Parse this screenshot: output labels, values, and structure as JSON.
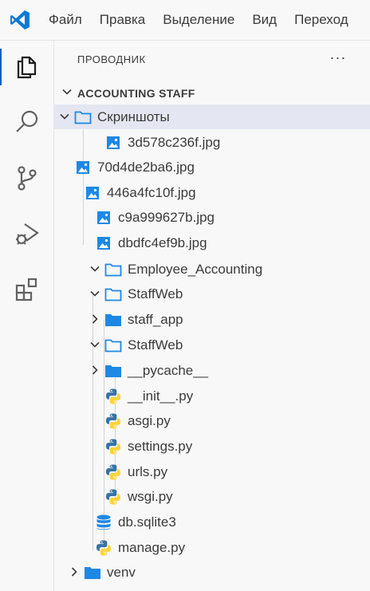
{
  "menu": {
    "items": [
      "Файл",
      "Правка",
      "Выделение",
      "Вид",
      "Переход"
    ]
  },
  "explorer": {
    "title": "ПРОВОДНИК",
    "more_actions": "···",
    "workspace": "ACCOUNTING STAFF"
  },
  "tree": [
    {
      "label": "Скриншоты",
      "kind": "folder",
      "open": true,
      "icon": "folder-open-icon"
    },
    {
      "label": "3d578c236f.jpg",
      "kind": "image",
      "icon": "image-file-icon"
    },
    {
      "label": "70d4de2ba6.jpg",
      "kind": "image",
      "icon": "image-file-icon"
    },
    {
      "label": "446a4fc10f.jpg",
      "kind": "image",
      "icon": "image-file-icon"
    },
    {
      "label": "c9a999627b.jpg",
      "kind": "image",
      "icon": "image-file-icon"
    },
    {
      "label": "dbdfc4ef9b.jpg",
      "kind": "image",
      "icon": "image-file-icon"
    },
    {
      "label": "Employee_Accounting",
      "kind": "folder",
      "open": true,
      "icon": "folder-open-icon"
    },
    {
      "label": "StaffWeb",
      "kind": "folder",
      "open": true,
      "icon": "folder-open-icon"
    },
    {
      "label": "staff_app",
      "kind": "folder",
      "open": false,
      "icon": "folder-closed-icon"
    },
    {
      "label": "StaffWeb",
      "kind": "folder",
      "open": true,
      "icon": "folder-open-icon"
    },
    {
      "label": "__pycache__",
      "kind": "folder",
      "open": false,
      "icon": "folder-closed-icon"
    },
    {
      "label": "__init__.py",
      "kind": "python",
      "icon": "python-file-icon"
    },
    {
      "label": "asgi.py",
      "kind": "python",
      "icon": "python-file-icon"
    },
    {
      "label": "settings.py",
      "kind": "python",
      "icon": "python-file-icon"
    },
    {
      "label": "urls.py",
      "kind": "python",
      "icon": "python-file-icon"
    },
    {
      "label": "wsgi.py",
      "kind": "python",
      "icon": "python-file-icon"
    },
    {
      "label": "db.sqlite3",
      "kind": "database",
      "icon": "database-file-icon"
    },
    {
      "label": "manage.py",
      "kind": "python",
      "icon": "python-file-icon"
    },
    {
      "label": "venv",
      "kind": "folder",
      "open": false,
      "icon": "folder-closed-icon"
    }
  ],
  "activity_bar": [
    "explorer-icon",
    "search-icon",
    "source-control-icon",
    "run-debug-icon",
    "extensions-icon"
  ],
  "colors": {
    "accent": "#005fb8",
    "folder": "#1e88e5",
    "selection": "#e4e6f1"
  }
}
